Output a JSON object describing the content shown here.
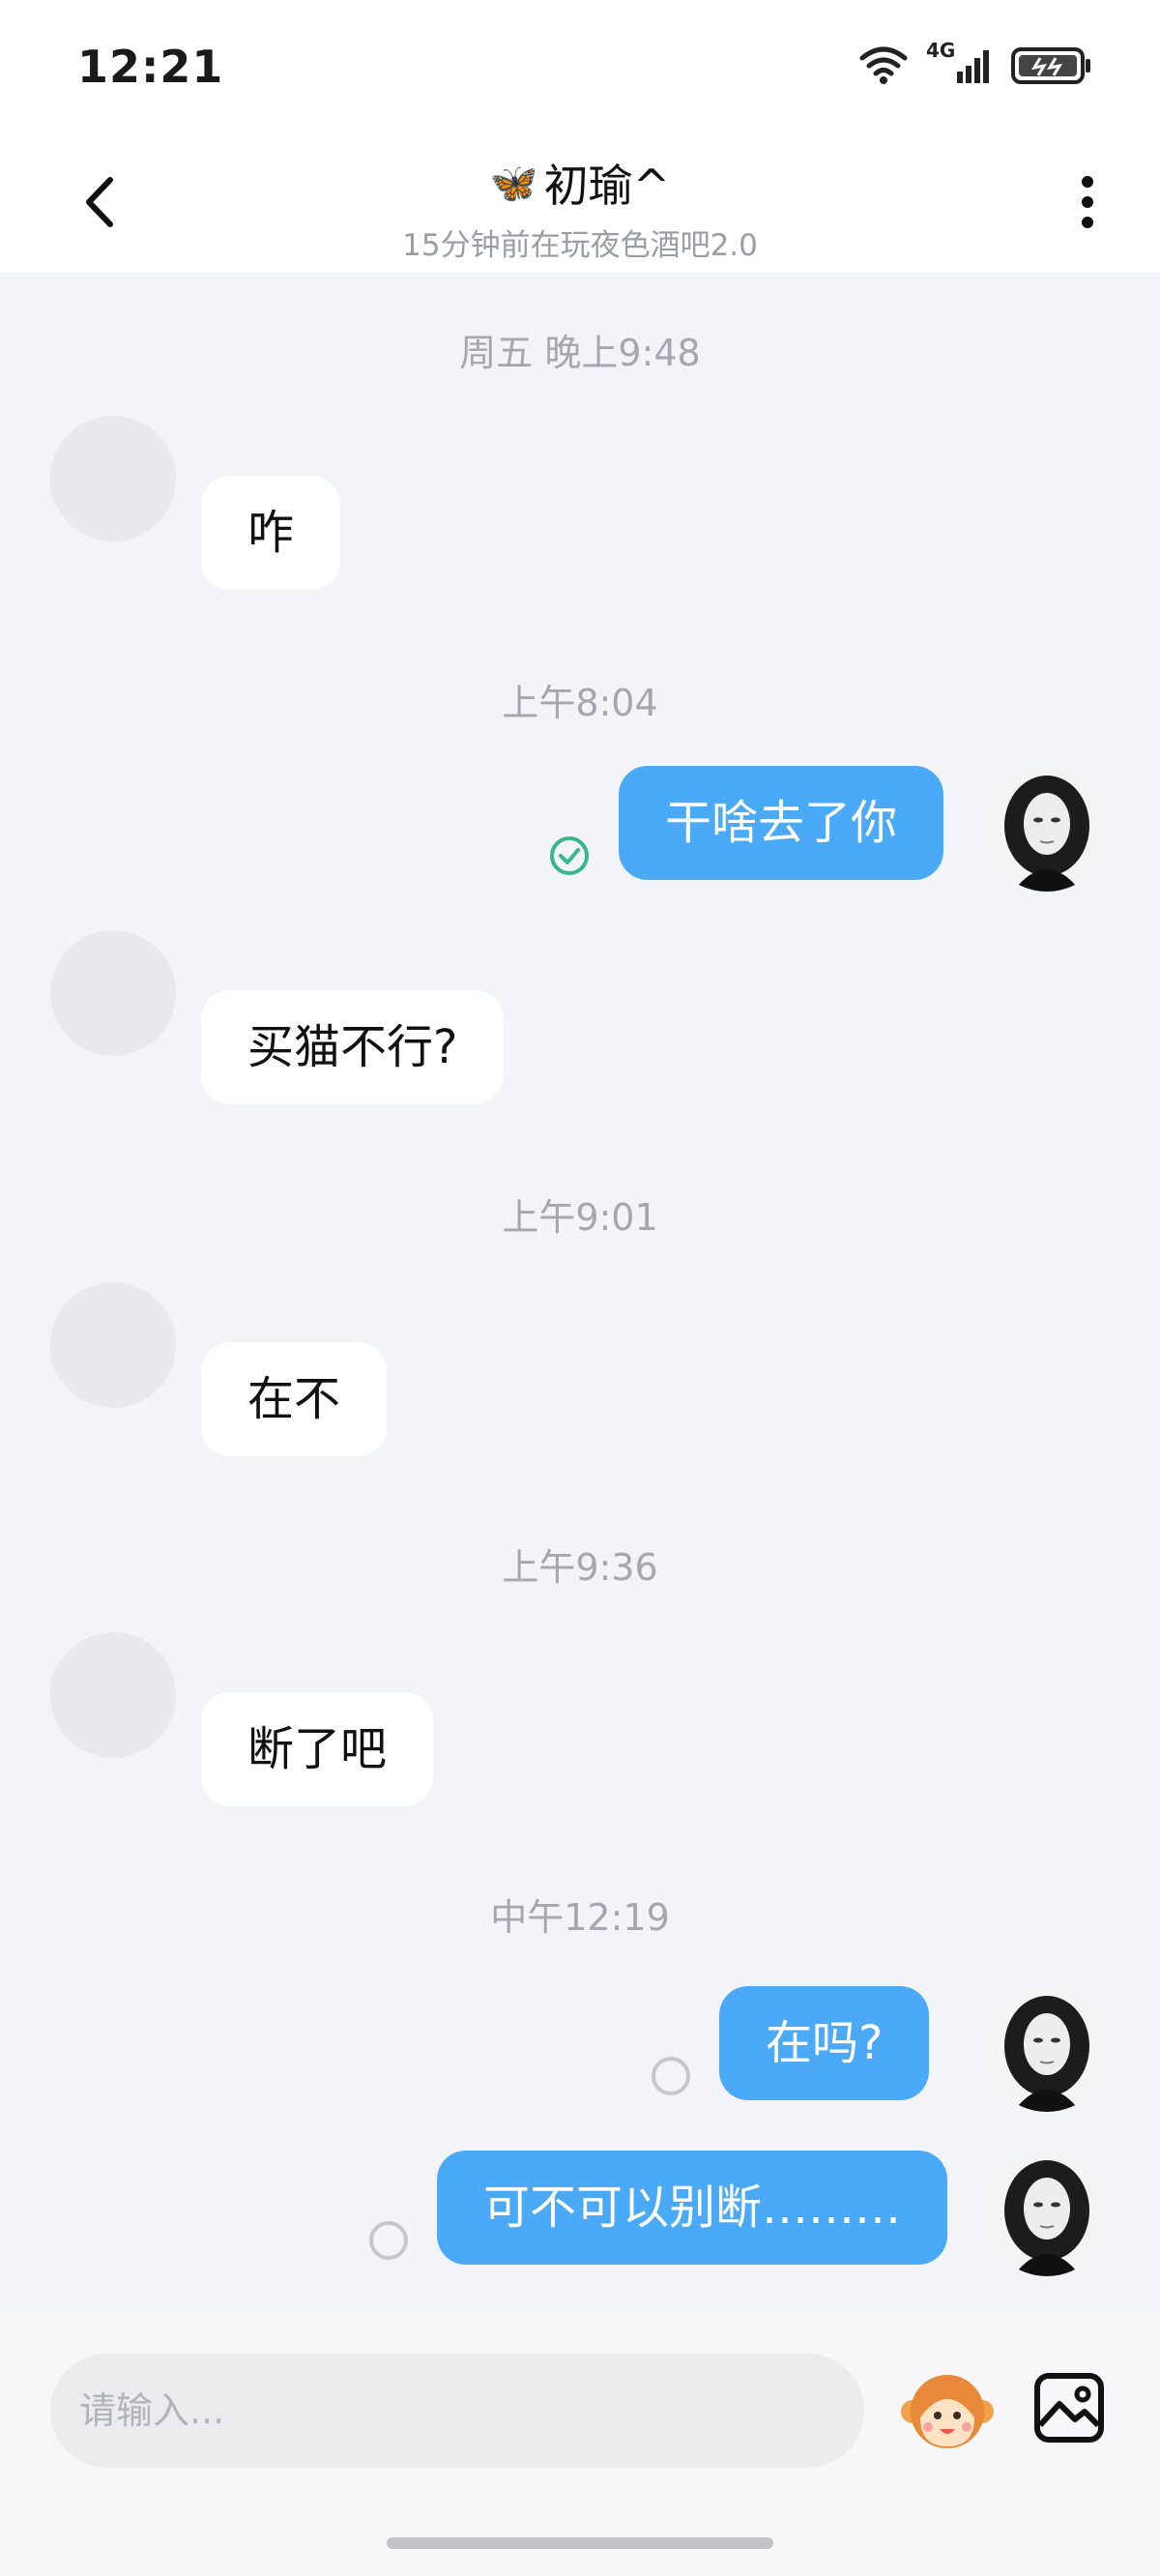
{
  "status_bar": {
    "time": "12:21",
    "network": "4G"
  },
  "header": {
    "back_icon": "chevron-left-icon",
    "title_emoji": "🦋",
    "title": "初瑜^",
    "subtitle": "15分钟前在玩夜色酒吧2.0",
    "more_icon": "more-vertical-icon"
  },
  "timestamps": [
    "周五 晚上9:48",
    "上午8:04",
    "上午9:01",
    "上午9:36",
    "中午12:19"
  ],
  "messages": [
    {
      "side": "in",
      "text": "咋"
    },
    {
      "side": "out",
      "text": "干啥去了你",
      "status": "read"
    },
    {
      "side": "in",
      "text": "买猫不行?"
    },
    {
      "side": "in",
      "text": "在不"
    },
    {
      "side": "in",
      "text": "断了吧"
    },
    {
      "side": "out",
      "text": "在吗?",
      "status": "sent"
    },
    {
      "side": "out",
      "text": "可不可以别断………",
      "status": "sent"
    }
  ],
  "input": {
    "placeholder": "请输入..."
  },
  "colors": {
    "bubble_out": "#4aaaf7",
    "bubble_in": "#ffffff",
    "read_check": "#3bb58a"
  }
}
